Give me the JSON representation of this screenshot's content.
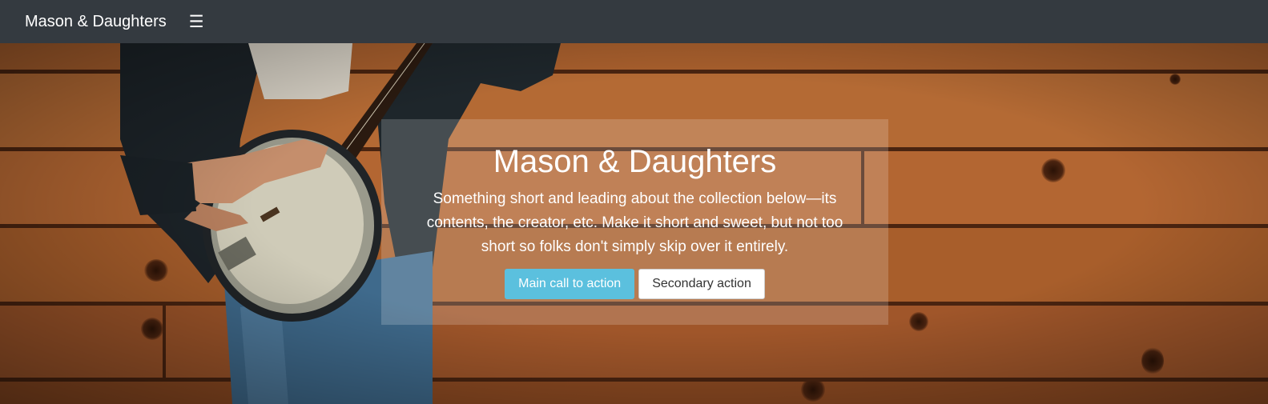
{
  "navbar": {
    "brand": "Mason & Daughters",
    "menu_icon": "hamburger-menu-icon",
    "menu_glyph": "☰"
  },
  "hero": {
    "title": "Mason & Daughters",
    "lead": "Something short and leading about the collection below—its contents, the creator, etc. Make it short and sweet, but not too short so folks don't simply skip over it entirely.",
    "primary_action": "Main call to action",
    "secondary_action": "Secondary action",
    "background_image": "man-playing-banjo-against-wood-wall"
  },
  "colors": {
    "navbar": "#343a40",
    "primary_button": "#5bc0de",
    "secondary_button": "#ffffff",
    "wood": "#b56a35"
  }
}
